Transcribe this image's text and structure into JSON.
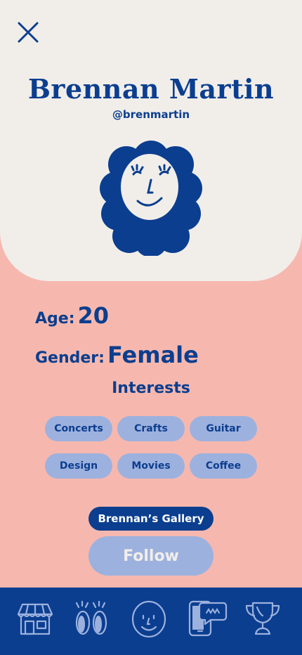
{
  "profile": {
    "name": "Brennan Martin",
    "handle": "@brenmartin"
  },
  "stats": {
    "age_label": "Age:",
    "age_value": "20",
    "gender_label": "Gender:",
    "gender_value": "Female"
  },
  "interests": {
    "title": "Interests",
    "items": [
      "Concerts",
      "Crafts",
      "Guitar",
      "Design",
      "Movies",
      "Coffee"
    ]
  },
  "actions": {
    "gallery_label": "Brennan’s Gallery",
    "follow_label": "Follow"
  },
  "nav": {
    "items": [
      "shop-icon",
      "feet-icon",
      "profile-face-icon",
      "phone-chat-icon",
      "trophy-icon"
    ]
  },
  "colors": {
    "primary": "#0B3E8F",
    "background": "#F6B8AE",
    "card": "#F1EEEA",
    "chip": "#9DB1DE"
  }
}
